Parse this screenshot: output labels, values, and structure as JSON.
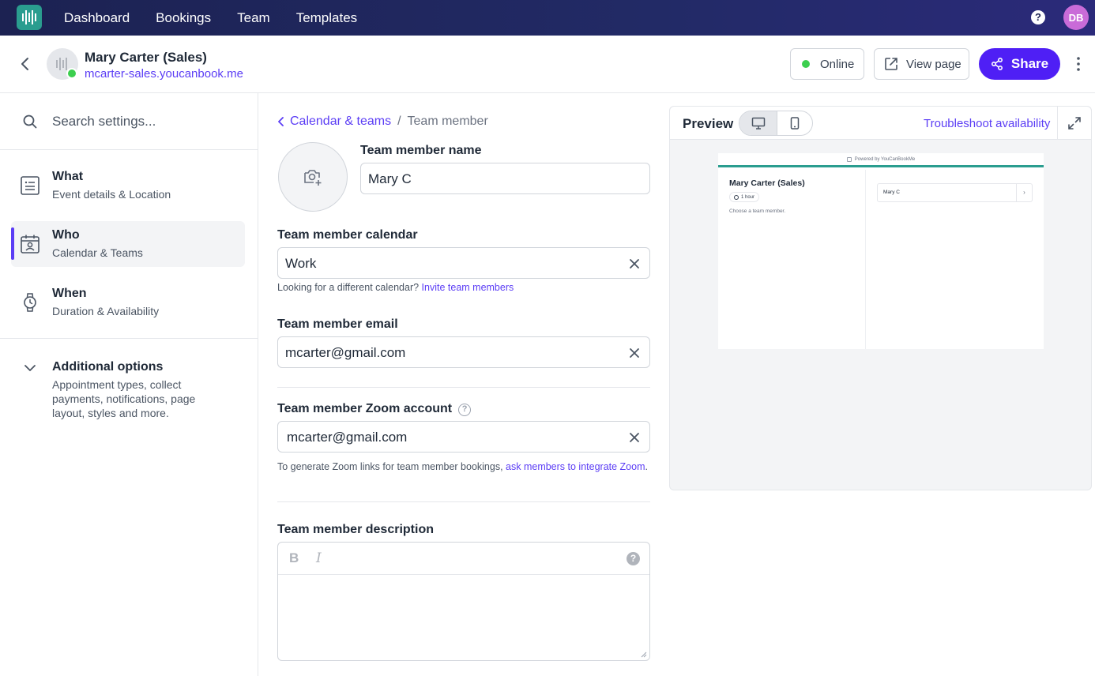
{
  "topnav": {
    "logo_icon": "youcanbookme-logo-icon",
    "links": [
      "Dashboard",
      "Bookings",
      "Team",
      "Templates"
    ],
    "help_icon": "?",
    "user_initials": "DB"
  },
  "header": {
    "page_name": "Mary Carter (Sales)",
    "page_url": "mcarter-sales.youcanbook.me",
    "status_label": "Online",
    "view_page_label": "View page",
    "share_label": "Share"
  },
  "sidebar": {
    "search_placeholder": "Search settings...",
    "items": [
      {
        "title": "What",
        "subtitle": "Event details & Location",
        "icon": "document-icon"
      },
      {
        "title": "Who",
        "subtitle": "Calendar & Teams",
        "icon": "team-calendar-icon"
      },
      {
        "title": "When",
        "subtitle": "Duration & Availability",
        "icon": "watch-icon"
      }
    ],
    "additional": {
      "title": "Additional options",
      "description": "Appointment types, collect payments, notifications, page layout, styles and more."
    }
  },
  "form": {
    "breadcrumb_parent": "Calendar & teams",
    "breadcrumb_separator": "/",
    "breadcrumb_current": "Team member",
    "name_label": "Team member name",
    "name_value": "Mary C",
    "calendar_label": "Team member calendar",
    "calendar_value": "Work",
    "calendar_hint": "Looking for a different calendar?",
    "calendar_hint_link": "Invite team members",
    "email_label": "Team member email",
    "email_value": "mcarter@gmail.com",
    "zoom_label": "Team member Zoom account",
    "zoom_value": "mcarter@gmail.com",
    "zoom_hint": "To generate Zoom links for team member bookings,",
    "zoom_hint_link": "ask members to integrate Zoom",
    "zoom_hint_end": ".",
    "description_label": "Team member description",
    "description_value": "",
    "bold_label": "B",
    "italic_label": "I",
    "editor_help": "?"
  },
  "preview": {
    "title": "Preview",
    "troubleshoot_label": "Troubleshoot availability",
    "mini": {
      "powered_by": "Powered by YouCanBookMe",
      "name": "Mary Carter (Sales)",
      "duration": "1 hour",
      "choose_text": "Choose a team member.",
      "member_name": "Mary C",
      "chevron": "›"
    }
  },
  "colors": {
    "accent": "#5b3df5",
    "share_button": "#4f1ff5",
    "online": "#3ccf4e",
    "nav_bg": "#1c2252",
    "brand_teal": "#2a9d8f"
  }
}
